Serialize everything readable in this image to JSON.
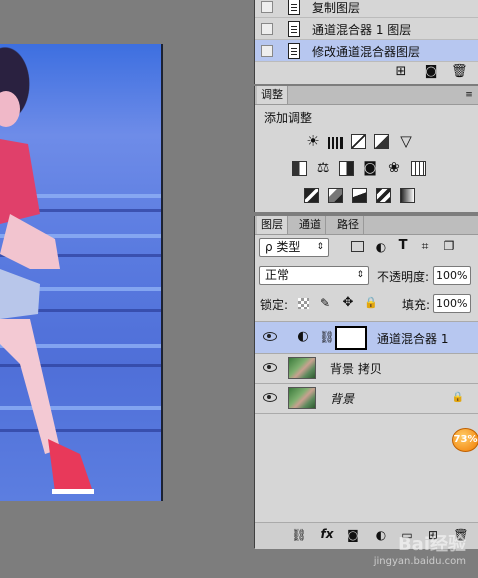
{
  "layers_top": {
    "rows": [
      {
        "label": "复制图层"
      },
      {
        "label": "通道混合器 1 图层"
      },
      {
        "label": "修改通道混合器图层"
      }
    ],
    "toolbar": {
      "new_icon": "new-layer-icon",
      "camera_icon": "camera-icon",
      "trash_icon": "trash-icon"
    }
  },
  "adjustments": {
    "tab": "调整",
    "heading": "添加调整"
  },
  "layers_panel": {
    "tabs": [
      "图层",
      "通道",
      "路径"
    ],
    "filter_label": "ρ 类型",
    "blend_mode": "正常",
    "opacity_label": "不透明度:",
    "opacity_value": "100%",
    "lock_label": "锁定:",
    "fill_label": "填充:",
    "fill_value": "100%",
    "layers": [
      {
        "name": "通道混合器 1",
        "selected": true
      },
      {
        "name": "背景 拷贝",
        "selected": false
      },
      {
        "name": "背景",
        "selected": false,
        "locked": true
      }
    ],
    "footer_fx": "fx"
  },
  "overlay": {
    "badge": "73%",
    "watermark": "Bai经验",
    "watermark_url": "jingyan.baidu.com"
  },
  "colors": {
    "panel_bg": "#d6d6d6",
    "selected_row": "#b7c7f0",
    "workspace": "#7d7d7d"
  }
}
